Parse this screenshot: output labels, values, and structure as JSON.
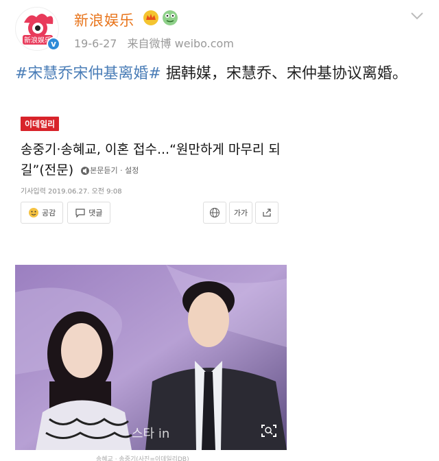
{
  "header": {
    "username": "新浪娱乐",
    "avatar_text": "新浪娱乐",
    "date": "19-6-27",
    "source": "来自微博 weibo.com",
    "verified_color": "#2e8bd8",
    "username_color": "#e8741b"
  },
  "post": {
    "hashtag": "#宋慧乔宋仲基离婚#",
    "body": " 据韩媒，宋慧乔、宋仲基协议离婚。"
  },
  "news": {
    "logo": "이데일리",
    "title": "송중기·송혜교, 이혼 접수...“원만하게 마무리 되길”(전문)",
    "listen_label": "본문듣기 · 설정",
    "date": "기사입력 2019.06.27. 오전 9:08",
    "like_label": "공감",
    "comment_label": "댓글",
    "font_label": "가가"
  },
  "photo": {
    "watermark": "스타 in"
  },
  "caption": {
    "text": "송혜교 · 송중기(사진=이데일리DB)"
  }
}
